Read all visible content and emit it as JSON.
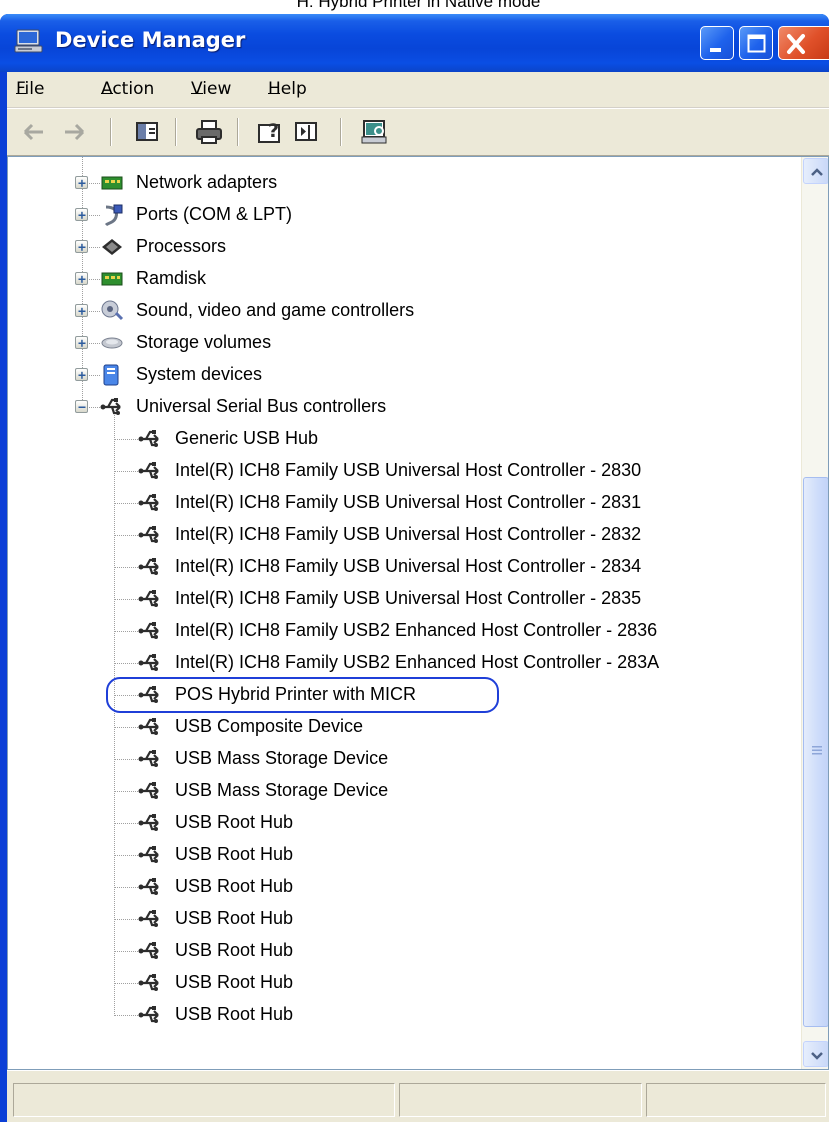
{
  "caption": "H: Hybrid Printer in Native mode",
  "window": {
    "title": "Device Manager",
    "controls": {
      "minimize": "minimize",
      "maximize": "maximize",
      "close": "close"
    }
  },
  "menu": [
    {
      "label": "File",
      "mnemonic": "F"
    },
    {
      "label": "Action",
      "mnemonic": "A"
    },
    {
      "label": "View",
      "mnemonic": "V"
    },
    {
      "label": "Help",
      "mnemonic": "H"
    }
  ],
  "toolbar": [
    "back-arrow-icon",
    "forward-arrow-icon",
    "properties-pane-icon",
    "print-icon",
    "help-icon",
    "show-hide-pane-icon",
    "scan-hardware-icon"
  ],
  "tree": {
    "categories": [
      {
        "label": "Network adapters",
        "expanded": false,
        "icon": "network-adapter-icon"
      },
      {
        "label": "Ports (COM & LPT)",
        "expanded": false,
        "icon": "port-icon"
      },
      {
        "label": "Processors",
        "expanded": false,
        "icon": "processor-icon"
      },
      {
        "label": "Ramdisk",
        "expanded": false,
        "icon": "ramdisk-icon"
      },
      {
        "label": "Sound, video and game controllers",
        "expanded": false,
        "icon": "sound-icon"
      },
      {
        "label": "Storage volumes",
        "expanded": false,
        "icon": "storage-volume-icon"
      },
      {
        "label": "System devices",
        "expanded": false,
        "icon": "system-device-icon"
      },
      {
        "label": "Universal Serial Bus controllers",
        "expanded": true,
        "icon": "usb-icon"
      }
    ],
    "usb_children": [
      "Generic USB Hub",
      "Intel(R) ICH8 Family USB Universal Host Controller - 2830",
      "Intel(R) ICH8 Family USB Universal Host Controller - 2831",
      "Intel(R) ICH8 Family USB Universal Host Controller - 2832",
      "Intel(R) ICH8 Family USB Universal Host Controller - 2834",
      "Intel(R) ICH8 Family USB Universal Host Controller - 2835",
      "Intel(R) ICH8 Family USB2 Enhanced Host Controller - 2836",
      "Intel(R) ICH8 Family USB2 Enhanced Host Controller - 283A",
      "POS Hybrid Printer with MICR",
      "USB Composite Device",
      "USB Mass Storage Device",
      "USB Mass Storage Device",
      "USB Root Hub",
      "USB Root Hub",
      "USB Root Hub",
      "USB Root Hub",
      "USB Root Hub",
      "USB Root Hub",
      "USB Root Hub"
    ],
    "highlighted_item": "POS Hybrid Printer with MICR",
    "highlight_color": "#1f3fd8"
  },
  "colors": {
    "titlebar": "#0a4ce0",
    "client": "#ece9d8",
    "close_button": "#e0512a"
  }
}
